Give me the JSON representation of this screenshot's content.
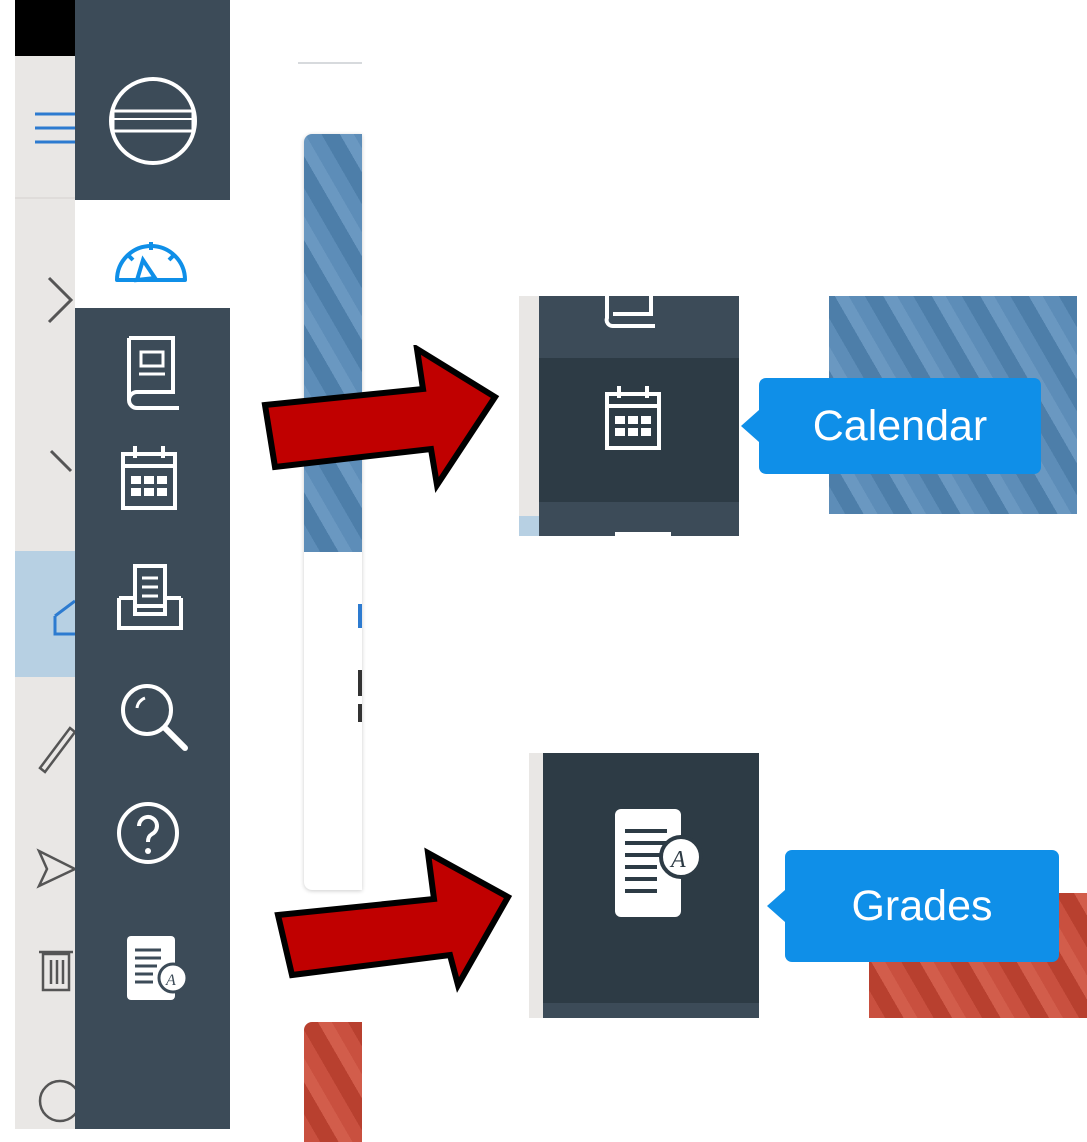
{
  "global_nav": {
    "items": [
      {
        "name": "account-icon"
      },
      {
        "name": "dashboard-icon",
        "active": true
      },
      {
        "name": "courses-icon"
      },
      {
        "name": "calendar-icon"
      },
      {
        "name": "inbox-icon"
      },
      {
        "name": "search-icon"
      },
      {
        "name": "help-icon"
      },
      {
        "name": "grades-icon"
      }
    ]
  },
  "callouts": {
    "calendar_tooltip": "Calendar",
    "grades_tooltip": "Grades"
  },
  "colors": {
    "nav_bg": "#3c4b58",
    "nav_active_bg": "#2d3b45",
    "active_icon": "#0f8fe8",
    "tooltip_bg": "#0f8fe8",
    "arrow_fill": "#c00000"
  }
}
